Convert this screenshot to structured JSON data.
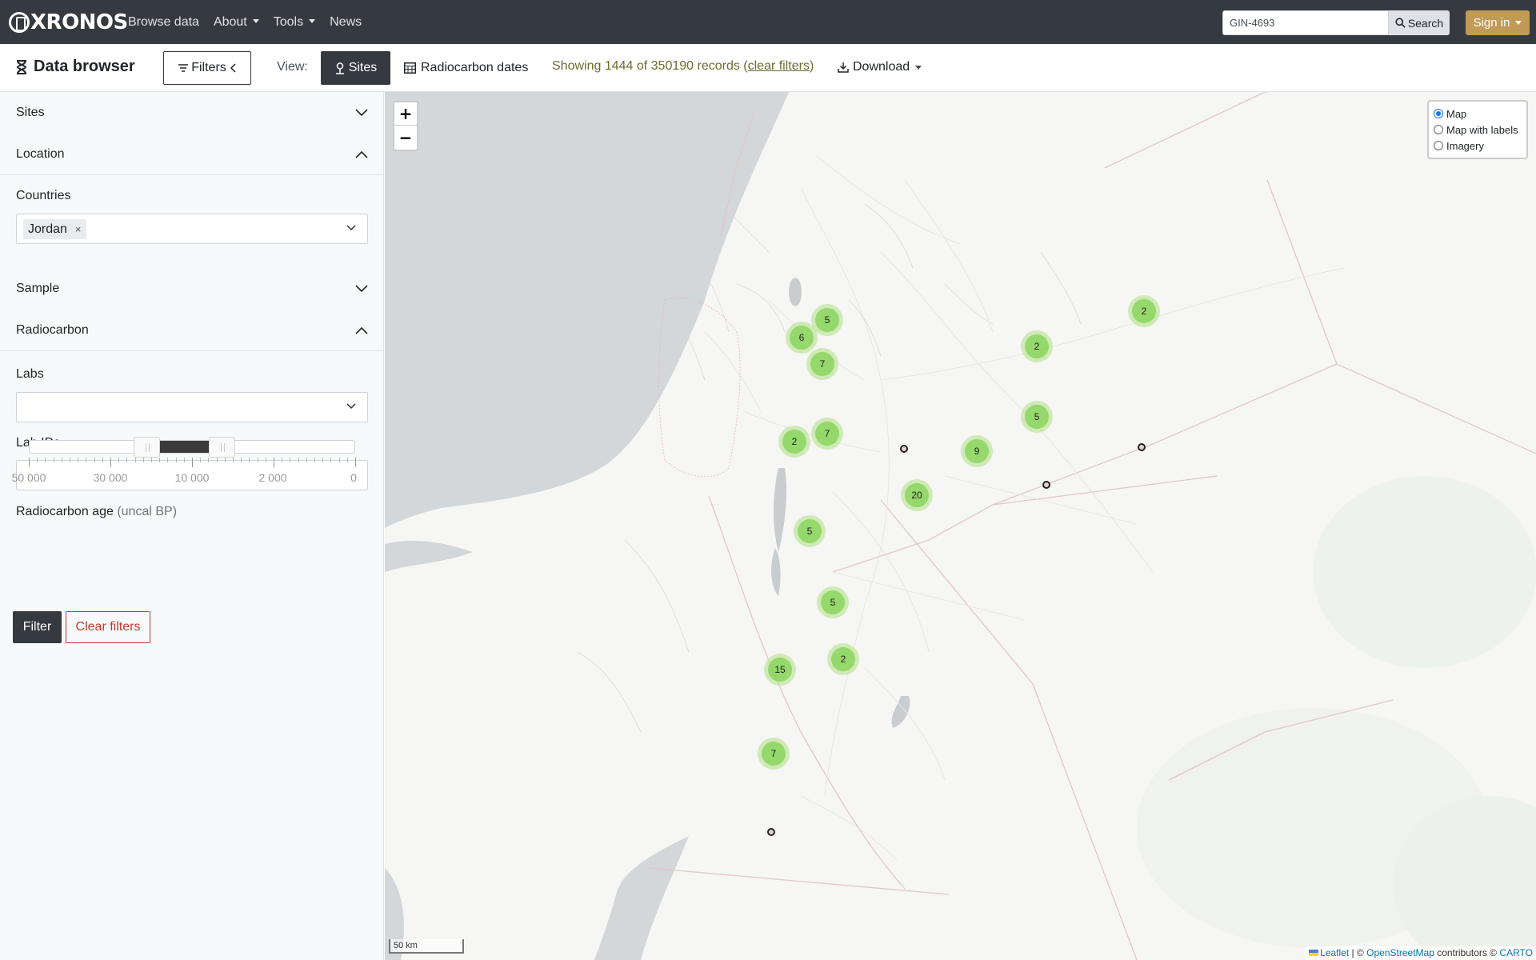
{
  "navbar": {
    "brand": "XRONOS",
    "links": [
      "Browse data",
      "About",
      "Tools",
      "News"
    ],
    "search_value": "GIN-4693",
    "search_label": "Search",
    "signin_label": "Sign in"
  },
  "toolbar": {
    "title": "Data browser",
    "filters_label": "Filters",
    "view_label": "View:",
    "sites_label": "Sites",
    "radiocarbon_label": "Radiocarbon dates",
    "showing_prefix": "Showing 1444 of 350190 records (",
    "clear_filters_link": "clear filters",
    "showing_suffix": ")",
    "download_label": "Download"
  },
  "sidebar": {
    "sections": {
      "sites": "Sites",
      "location": "Location",
      "sample": "Sample",
      "radiocarbon": "Radiocarbon"
    },
    "countries_label": "Countries",
    "country_tag": "Jordan",
    "tag_remove": "×",
    "labs_label": "Labs",
    "lab_ids_label": "Lab IDs",
    "rc_age_label": "Radiocarbon age",
    "rc_age_unit": "(uncal BP)",
    "slider_ticks": [
      "50 000",
      "30 000",
      "10 000",
      "2 000",
      "0"
    ],
    "filter_button": "Filter",
    "clear_button": "Clear filters"
  },
  "map": {
    "zoom_in": "+",
    "zoom_out": "−",
    "layers": [
      "Map",
      "Map with labels",
      "Imagery"
    ],
    "selected_layer": "Map",
    "clusters": [
      {
        "count": "5"
      },
      {
        "count": "6"
      },
      {
        "count": "7"
      },
      {
        "count": "2"
      },
      {
        "count": "2"
      },
      {
        "count": "5"
      },
      {
        "count": "2"
      },
      {
        "count": "7"
      },
      {
        "count": "9"
      },
      {
        "count": "20"
      },
      {
        "count": "5"
      },
      {
        "count": "5"
      },
      {
        "count": "2"
      },
      {
        "count": "15"
      },
      {
        "count": "7"
      }
    ],
    "scale_label": "50 km",
    "attribution": {
      "leaflet": "Leaflet",
      "sep1": " | © ",
      "osm": "OpenStreetMap",
      "middle": " contributors © ",
      "carto": "CARTO"
    },
    "colors": {
      "sea": "#d4d8db",
      "land": "#f6f6f4",
      "cluster_outer": "#b5e28c",
      "cluster_inner": "#6ecc39"
    }
  }
}
